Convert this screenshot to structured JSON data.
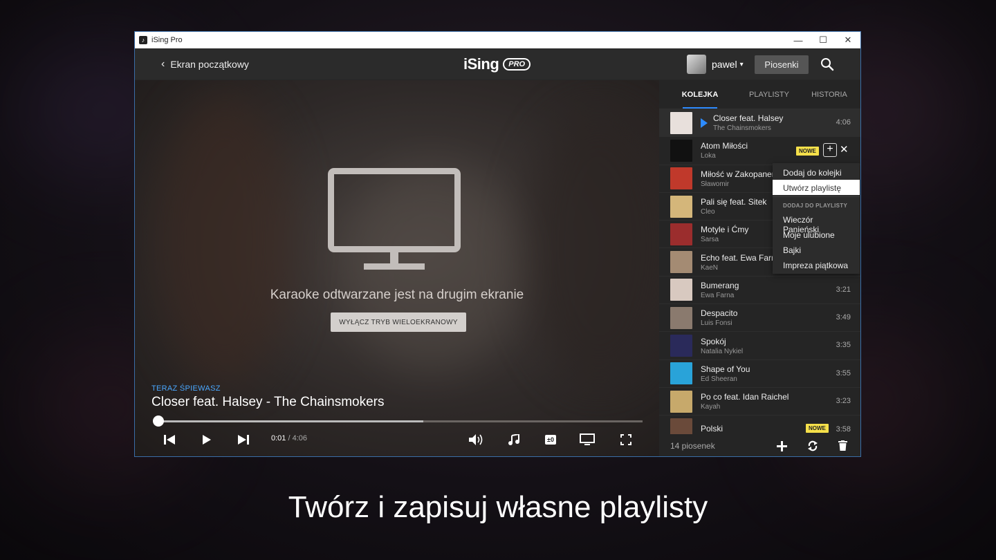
{
  "window": {
    "title": "iSing Pro"
  },
  "topbar": {
    "back_label": "Ekran początkowy",
    "logo_text": "iSing",
    "logo_badge": "PRO",
    "username": "pawel",
    "songs_button": "Piosenki"
  },
  "player": {
    "message": "Karaoke odtwarzane jest na drugim ekranie",
    "multiscreen_button": "WYŁĄCZ TRYB WIELOEKRANOWY",
    "now_singing_label": "TERAZ ŚPIEWASZ",
    "now_singing_title": "Closer feat. Halsey - The Chainsmokers",
    "time_current": "0:01",
    "time_total": "4:06",
    "progress_pct": 0.55,
    "pitch_label": "±0"
  },
  "sidebar": {
    "tabs": [
      "KOLEJKA",
      "PLAYLISTY",
      "HISTORIA"
    ],
    "queue": [
      {
        "title": "Closer feat. Halsey",
        "artist": "The Chainsmokers",
        "duration": "4:06",
        "thumb": "#e8e0dc"
      },
      {
        "title": "Atom Miłości",
        "artist": "Loka",
        "duration": "",
        "badge": "NOWE",
        "thumb": "#111111"
      },
      {
        "title": "Miłość w Zakopanem",
        "artist": "Sławomir",
        "duration": "",
        "thumb": "#c0392b"
      },
      {
        "title": "Pali się feat. Sitek",
        "artist": "Cleo",
        "duration": "",
        "thumb": "#d4b67a"
      },
      {
        "title": "Motyle i Ćmy",
        "artist": "Sarsa",
        "duration": "",
        "thumb": "#9b2d2d"
      },
      {
        "title": "Echo feat. Ewa Farna",
        "artist": "KaeN",
        "duration": "",
        "thumb": "#a48b73"
      },
      {
        "title": "Bumerang",
        "artist": "Ewa Farna",
        "duration": "3:21",
        "thumb": "#d8c9c0"
      },
      {
        "title": "Despacito",
        "artist": "Luis Fonsi",
        "duration": "3:49",
        "thumb": "#8a7a6e"
      },
      {
        "title": "Spokój",
        "artist": "Natalia Nykiel",
        "duration": "3:35",
        "thumb": "#2a2a5a"
      },
      {
        "title": "Shape of You",
        "artist": "Ed Sheeran",
        "duration": "3:55",
        "thumb": "#29a3d9"
      },
      {
        "title": "Po co feat. Idan Raichel",
        "artist": "Kayah",
        "duration": "3:23",
        "thumb": "#c7a96b"
      },
      {
        "title": "Polski",
        "artist": "",
        "duration": "3:58",
        "badge": "NOWE",
        "thumb": "#6a4a3a"
      }
    ],
    "count": "14 piosenek"
  },
  "context_menu": {
    "items": [
      "Dodaj do kolejki",
      "Utwórz playlistę"
    ],
    "header": "DODAJ DO PLAYLISTY",
    "playlists": [
      "Wieczór Panieński",
      "Moje ulubione",
      "Bajki",
      "Impreza piątkowa"
    ]
  },
  "caption": "Twórz i zapisuj własne playlisty",
  "colors": {
    "accent": "#2d8bff",
    "badge": "#f5e04a"
  }
}
